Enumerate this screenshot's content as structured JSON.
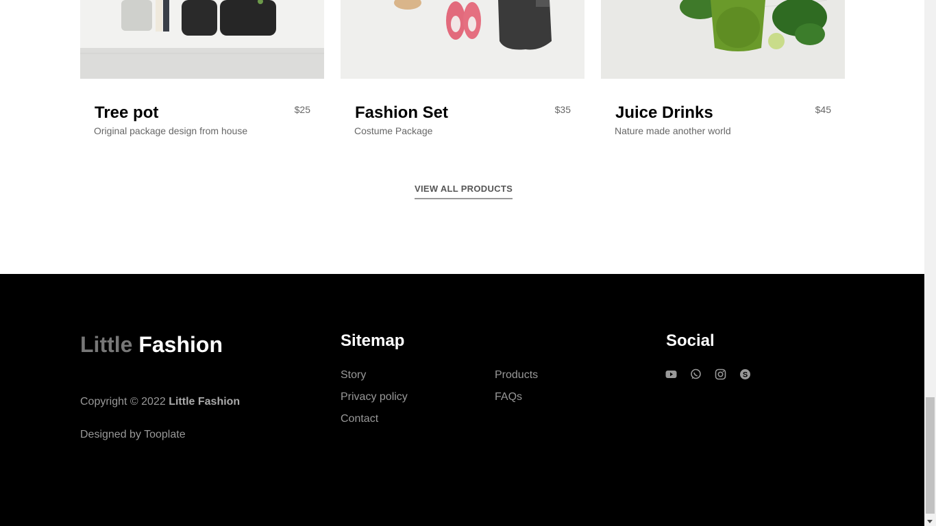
{
  "products": [
    {
      "title": "Tree pot",
      "subtitle": "Original package design from house",
      "price": "$25"
    },
    {
      "title": "Fashion Set",
      "subtitle": "Costume Package",
      "price": "$35"
    },
    {
      "title": "Juice Drinks",
      "subtitle": "Nature made another world",
      "price": "$45"
    }
  ],
  "view_all": "VIEW ALL PRODUCTS",
  "footer": {
    "brand_part1": "Little",
    "brand_part2": "Fashion",
    "copyright_prefix": "Copyright © 2022",
    "copyright_brand": "Little Fashion",
    "designed_by": "Designed by Tooplate",
    "sitemap_title": "Sitemap",
    "sitemap_links": [
      "Story",
      "Privacy policy",
      "Contact",
      "Products",
      "FAQs"
    ],
    "social_title": "Social",
    "social_icons": [
      "youtube-icon",
      "whatsapp-icon",
      "instagram-icon",
      "skype-icon"
    ]
  }
}
